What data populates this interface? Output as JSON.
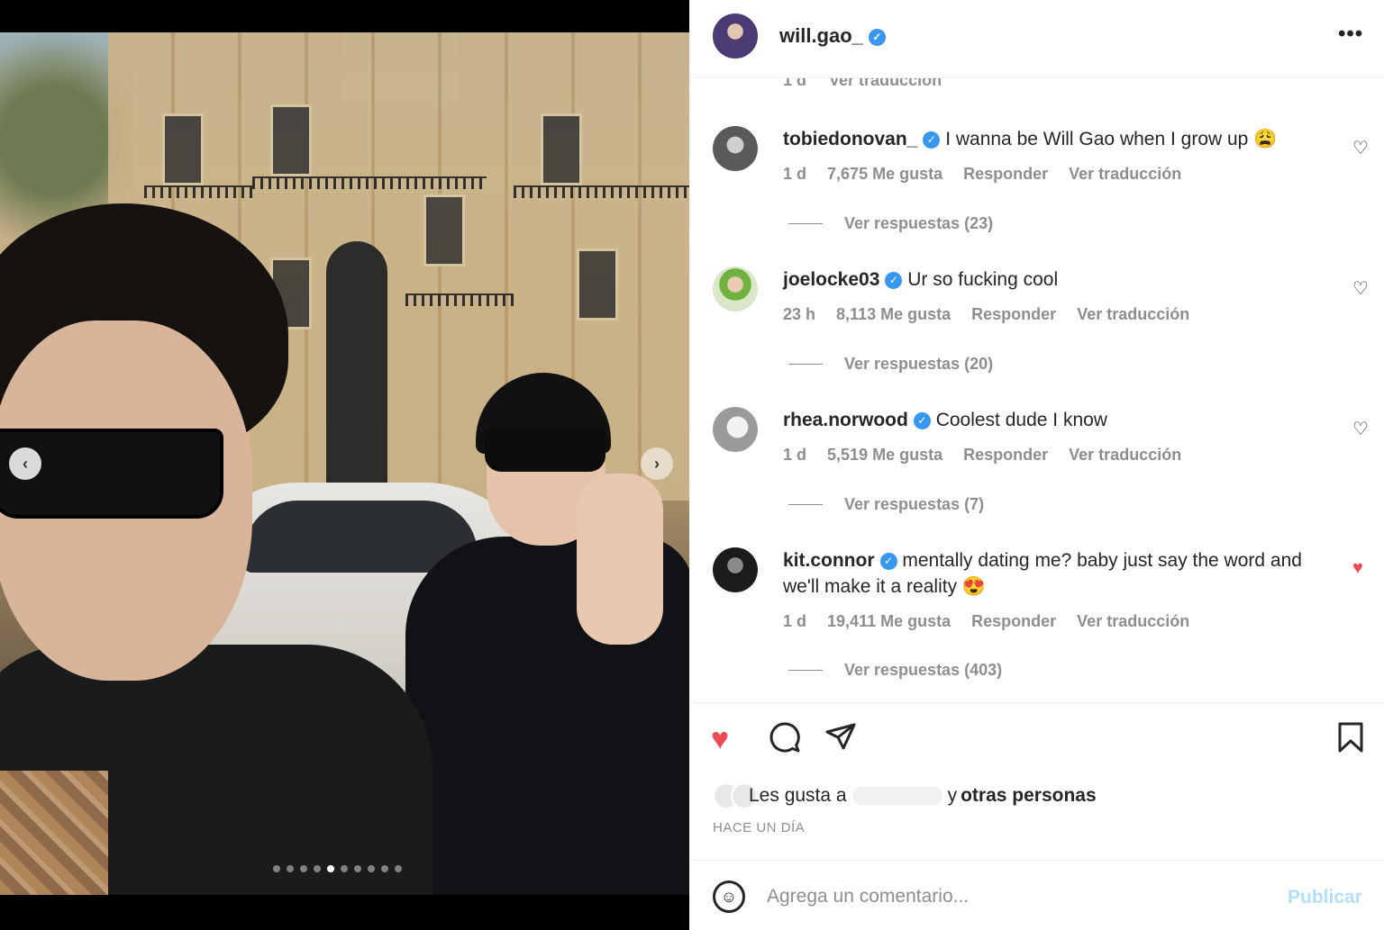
{
  "post": {
    "author": "will.gao_",
    "verified": true
  },
  "carousel": {
    "total_slides": 10,
    "active_slide": 5,
    "prev_icon": "chevron-left-icon",
    "next_icon": "chevron-right-icon"
  },
  "partial_comment": {
    "time": "1 d",
    "translate": "Ver traducción"
  },
  "comments": [
    {
      "user": "tobiedonovan_",
      "text": "I wanna be Will Gao when I grow up 😩",
      "time": "1 d",
      "likes": "7,675 Me gusta",
      "reply": "Responder",
      "translate": "Ver traducción",
      "replies": "Ver respuestas (23)",
      "liked": false
    },
    {
      "user": "joelocke03",
      "text": "Ur so fucking cool",
      "time": "23 h",
      "likes": "8,113 Me gusta",
      "reply": "Responder",
      "translate": "Ver traducción",
      "replies": "Ver respuestas (20)",
      "liked": false
    },
    {
      "user": "rhea.norwood",
      "text": "Coolest dude I know",
      "time": "1 d",
      "likes": "5,519 Me gusta",
      "reply": "Responder",
      "translate": "Ver traducción",
      "replies": "Ver respuestas (7)",
      "liked": false
    },
    {
      "user": "kit.connor",
      "text": "mentally dating me? baby just say the word and we'll make it a reality 😍",
      "time": "1 d",
      "likes": "19,411 Me gusta",
      "reply": "Responder",
      "translate": "Ver traducción",
      "replies": "Ver respuestas (403)",
      "liked": true
    }
  ],
  "likes_summary": {
    "prefix": "Les gusta a",
    "middle": "y",
    "suffix": "otras personas"
  },
  "timestamp": "HACE UN DÍA",
  "composer": {
    "placeholder": "Agrega un comentario...",
    "publish": "Publicar"
  },
  "colors": {
    "like_red": "#ed4956",
    "verified_blue": "#3897f0",
    "publish_disabled": "#b2dffc",
    "meta_gray": "#8e8e8e"
  }
}
